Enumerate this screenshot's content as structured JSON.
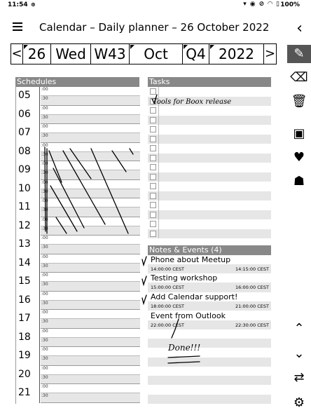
{
  "status_bar": {
    "time": "11:54",
    "battery": "100%"
  },
  "app_bar": {
    "title": "Calendar – Daily planner – 26 October 2022"
  },
  "date_nav": {
    "prev": "<",
    "day": "26",
    "weekday": "Wed",
    "week": "W43",
    "month": "Oct",
    "quarter": "Q4",
    "year": "2022",
    "next": ">"
  },
  "schedules": {
    "header": "Schedules",
    "minute_00": ":00",
    "minute_30": ":30",
    "hours": [
      "05",
      "06",
      "07",
      "08",
      "09",
      "10",
      "11",
      "12",
      "13",
      "14",
      "15",
      "16",
      "17",
      "18",
      "19",
      "20",
      "21"
    ]
  },
  "tasks": {
    "header": "Tasks",
    "items": [
      "Tools for Boox release"
    ]
  },
  "notes": {
    "header": "Notes & Events (4)",
    "events": [
      {
        "title": "Phone about Meetup",
        "start": "14:00:00 CEST",
        "end": "14:15:00 CEST"
      },
      {
        "title": "Testing workshop",
        "start": "15:00:00 CEST",
        "end": "16:00:00 CEST"
      },
      {
        "title": "Add Calendar support!",
        "start": "18:00:00 CEST",
        "end": "21:00:00 CEST"
      },
      {
        "title": "Event from Outlook",
        "start": "22:00:00 CEST",
        "end": "22:30:00 CEST"
      }
    ],
    "handwritten_note": "Done!!!"
  },
  "toolbar": {
    "tools": [
      "pen-icon",
      "eraser-icon",
      "trash-icon",
      "calendar-icon",
      "heart-pulse-icon",
      "robot-icon",
      "chevron-up-icon",
      "chevron-down-icon",
      "swap-icon",
      "gear-icon"
    ]
  }
}
